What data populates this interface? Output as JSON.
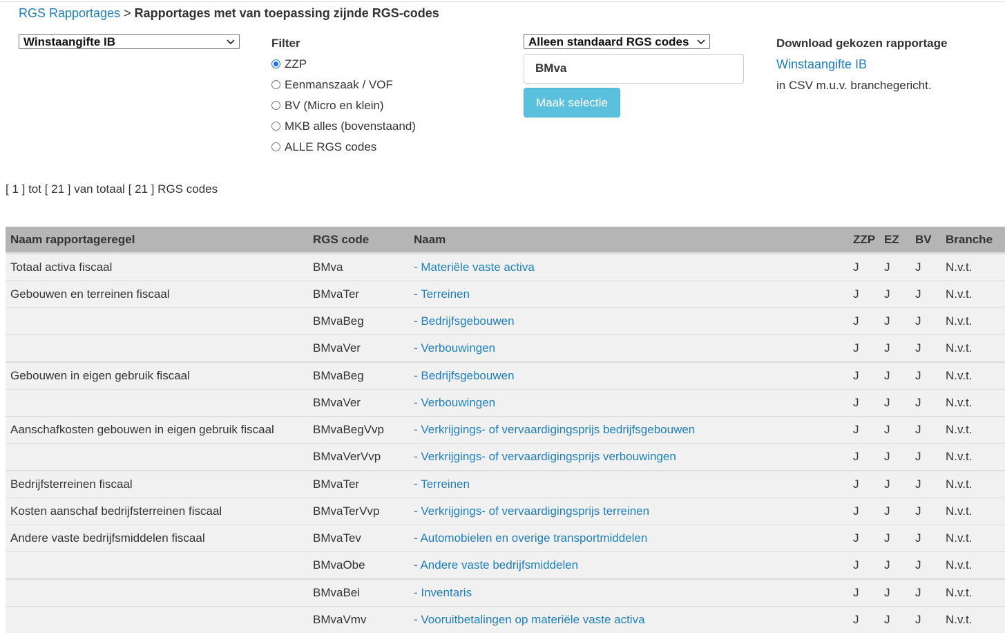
{
  "breadcrumb": {
    "root_label": "RGS Rapportages",
    "separator": ">",
    "current": "Rapportages met van toepassing zijnde RGS-codes"
  },
  "report_select": {
    "value": "Winstaangifte IB"
  },
  "filter": {
    "title": "Filter",
    "options": [
      {
        "label": "ZZP",
        "checked": true
      },
      {
        "label": "Eenmanszaak / VOF",
        "checked": false
      },
      {
        "label": "BV (Micro en klein)",
        "checked": false
      },
      {
        "label": "MKB alles (bovenstaand)",
        "checked": false
      },
      {
        "label": "ALLE RGS codes",
        "checked": false
      }
    ]
  },
  "codes_select": {
    "value": "Alleen standaard RGS codes"
  },
  "search": {
    "value": "BMva"
  },
  "select_button": {
    "label": "Maak selectie"
  },
  "download": {
    "title": "Download gekozen rapportage",
    "link_label": "Winstaangifte IB",
    "note": "in CSV m.u.v. branchegericht."
  },
  "result_count": "[ 1 ] tot [ 21 ] van totaal [ 21 ] RGS codes",
  "table": {
    "headers": [
      "Naam rapportageregel",
      "RGS code",
      "Naam",
      "ZZP",
      "EZ",
      "BV",
      "Branche"
    ],
    "rows": [
      {
        "regel": "Totaal activa fiscaal",
        "code": "BMva",
        "naam": "- Materiële vaste activa",
        "zzp": "J",
        "ez": "J",
        "bv": "J",
        "branche": "N.v.t.",
        "group_start": true
      },
      {
        "regel": "Gebouwen en terreinen fiscaal",
        "code": "BMvaTer",
        "naam": "- Terreinen",
        "zzp": "J",
        "ez": "J",
        "bv": "J",
        "branche": "N.v.t.",
        "group_start": false
      },
      {
        "regel": "",
        "code": "BMvaBeg",
        "naam": "- Bedrijfsgebouwen",
        "zzp": "J",
        "ez": "J",
        "bv": "J",
        "branche": "N.v.t.",
        "group_start": false
      },
      {
        "regel": "",
        "code": "BMvaVer",
        "naam": "- Verbouwingen",
        "zzp": "J",
        "ez": "J",
        "bv": "J",
        "branche": "N.v.t.",
        "group_start": false
      },
      {
        "regel": "Gebouwen in eigen gebruik fiscaal",
        "code": "BMvaBeg",
        "naam": "- Bedrijfsgebouwen",
        "zzp": "J",
        "ez": "J",
        "bv": "J",
        "branche": "N.v.t.",
        "group_start": true
      },
      {
        "regel": "",
        "code": "BMvaVer",
        "naam": "- Verbouwingen",
        "zzp": "J",
        "ez": "J",
        "bv": "J",
        "branche": "N.v.t.",
        "group_start": false
      },
      {
        "regel": "Aanschafkosten gebouwen in eigen gebruik fiscaal",
        "code": "BMvaBegVvp",
        "naam": "- Verkrijgings- of vervaardigingsprijs bedrijfsgebouwen",
        "zzp": "J",
        "ez": "J",
        "bv": "J",
        "branche": "N.v.t.",
        "group_start": false
      },
      {
        "regel": "",
        "code": "BMvaVerVvp",
        "naam": "- Verkrijgings- of vervaardigingsprijs verbouwingen",
        "zzp": "J",
        "ez": "J",
        "bv": "J",
        "branche": "N.v.t.",
        "group_start": false
      },
      {
        "regel": "Bedrijfsterreinen fiscaal",
        "code": "BMvaTer",
        "naam": "- Terreinen",
        "zzp": "J",
        "ez": "J",
        "bv": "J",
        "branche": "N.v.t.",
        "group_start": true
      },
      {
        "regel": "Kosten aanschaf bedrijfsterreinen fiscaal",
        "code": "BMvaTerVvp",
        "naam": "- Verkrijgings- of vervaardigingsprijs terreinen",
        "zzp": "J",
        "ez": "J",
        "bv": "J",
        "branche": "N.v.t.",
        "group_start": false
      },
      {
        "regel": "Andere vaste bedrijfsmiddelen fiscaal",
        "code": "BMvaTev",
        "naam": "- Automobielen en overige transportmiddelen",
        "zzp": "J",
        "ez": "J",
        "bv": "J",
        "branche": "N.v.t.",
        "group_start": false
      },
      {
        "regel": "",
        "code": "BMvaObe",
        "naam": "- Andere vaste bedrijfsmiddelen",
        "zzp": "J",
        "ez": "J",
        "bv": "J",
        "branche": "N.v.t.",
        "group_start": false
      },
      {
        "regel": "",
        "code": "BMvaBei",
        "naam": "- Inventaris",
        "zzp": "J",
        "ez": "J",
        "bv": "J",
        "branche": "N.v.t.",
        "group_start": true
      },
      {
        "regel": "",
        "code": "BMvaVmv",
        "naam": "- Vooruitbetalingen op materiële vaste activa",
        "zzp": "J",
        "ez": "J",
        "bv": "J",
        "branche": "N.v.t.",
        "group_start": false
      }
    ]
  }
}
